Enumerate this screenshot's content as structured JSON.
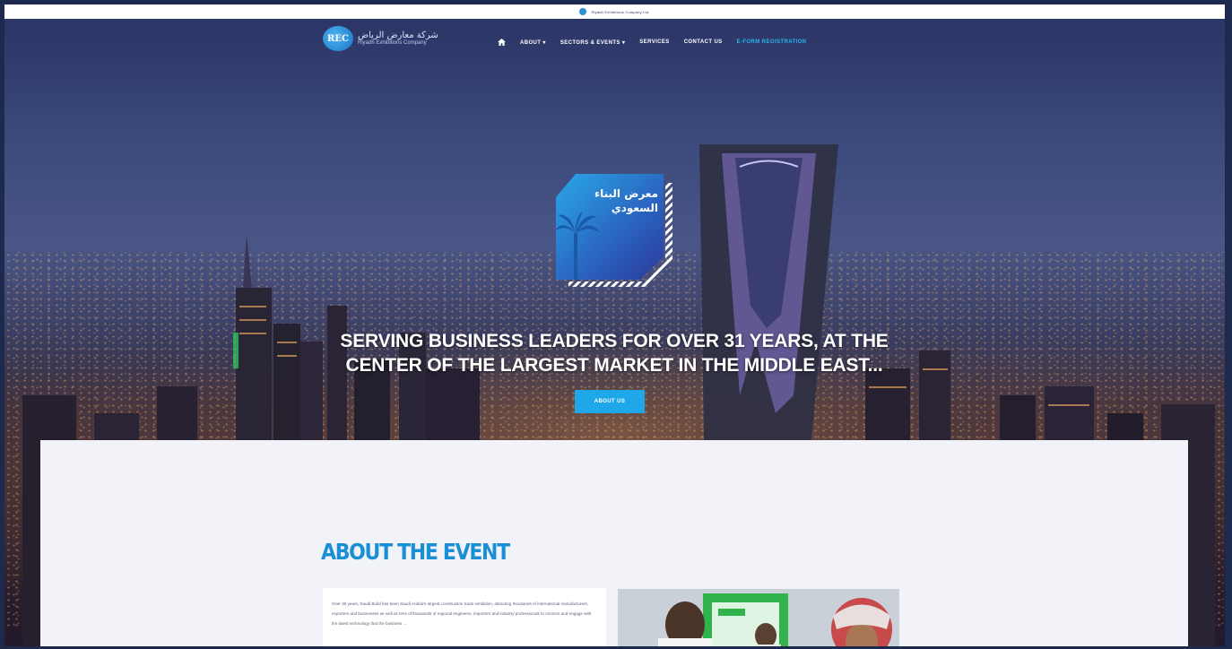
{
  "topbar": {
    "text": "Riyadh Exhibitions Company Ltd."
  },
  "nav": {
    "logo_badge": "REC",
    "logo_arabic": "شركة معارض الرياض",
    "logo_english": "Riyadh Exhibitions Company",
    "menu": [
      {
        "label": "ABOUT ▾"
      },
      {
        "label": "SECTORS & EVENTS ▾"
      },
      {
        "label": "SERVICES"
      },
      {
        "label": "CONTACT US"
      },
      {
        "label": "E-FORM REGISTRATION"
      }
    ]
  },
  "hero": {
    "emblem_title": "معرض البناء\nالسعودي",
    "headline": "SERVING BUSINESS LEADERS FOR OVER 31 YEARS, AT THE CENTER OF THE LARGEST MARKET IN THE MIDDLE EAST...",
    "button_label": "ABOUT US"
  },
  "about": {
    "title": "ABOUT THE EVENT",
    "text": "Over 30 years, Saudi Build has been Saudi Arabia's largest construction trade exhibition, attracting thousands of international manufacturers, exporters and businesses as well as tens of thousands of regional engineers, importers and industry professionals to connect and engage with the latest technology that the business ..."
  },
  "colors": {
    "accent": "#1ea7e9",
    "title": "#1b8fd6",
    "hero_top": "#2b3566"
  }
}
